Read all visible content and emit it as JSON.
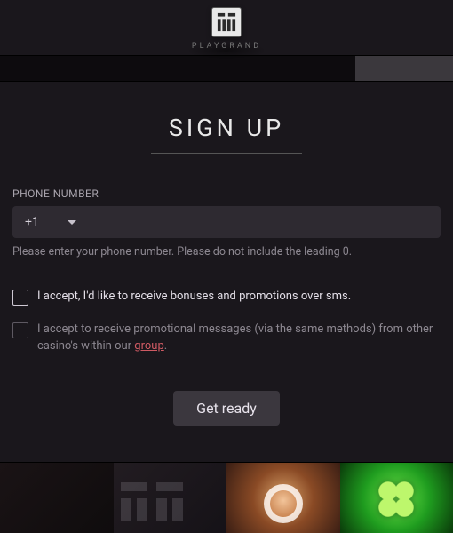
{
  "brand": "PLAYGRAND",
  "title": "SIGN UP",
  "phone": {
    "label": "PHONE NUMBER",
    "dial_code": "+1",
    "value": "",
    "placeholder": "",
    "hint": "Please enter your phone number. Please do not include the leading 0."
  },
  "checks": {
    "sms": {
      "checked": false,
      "label": "I accept, I'd like to receive bonuses and promotions over sms."
    },
    "group": {
      "checked": false,
      "label_pre": "I accept to receive promotional messages (via the same methods) from other casino's within our ",
      "link_text": "group",
      "label_post": "."
    }
  },
  "cta": "Get ready",
  "colors": {
    "bg": "#1a171c",
    "input_bg": "#2e2a31",
    "accent_link": "#cf5a63"
  }
}
